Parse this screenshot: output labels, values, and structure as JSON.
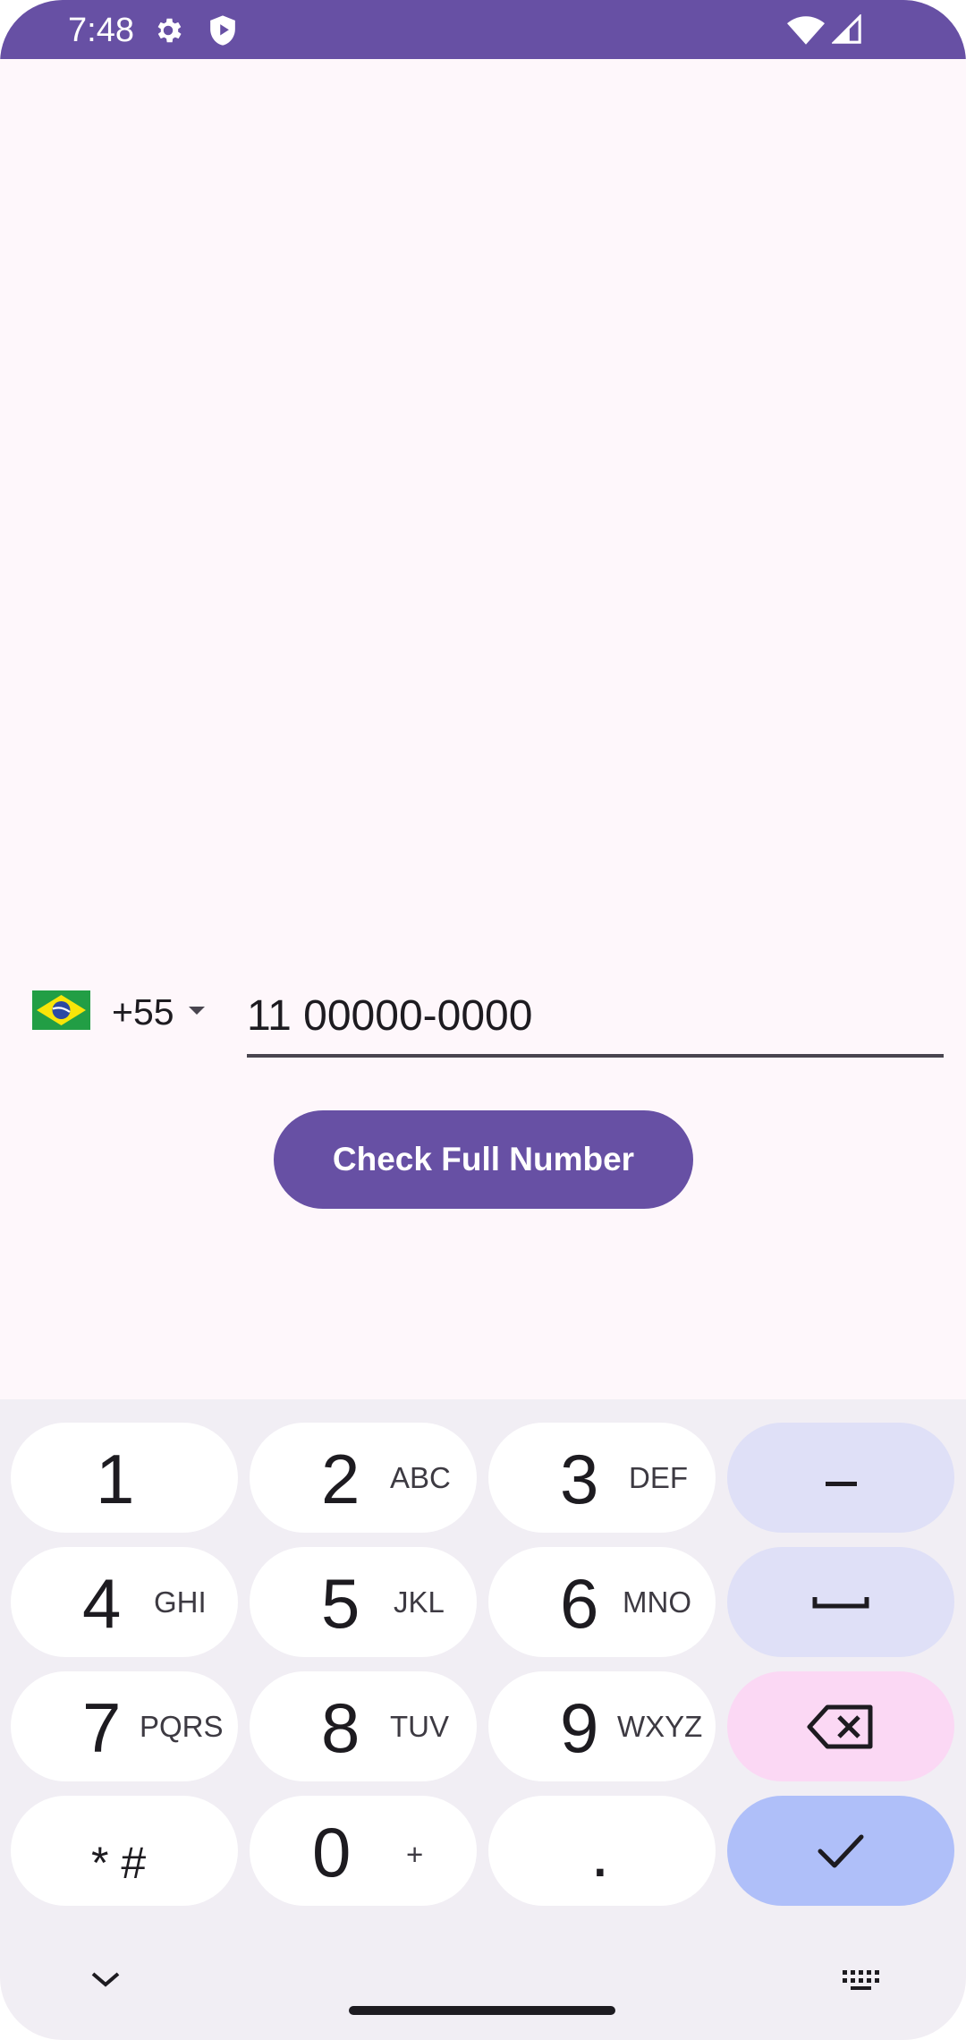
{
  "status_bar": {
    "time": "7:48",
    "icons": [
      "gear-icon",
      "shield-play-icon",
      "wifi-icon",
      "signal-icon"
    ],
    "background": "#6750a4"
  },
  "phone": {
    "flag": "brazil-flag-icon",
    "country_code": "+55",
    "number_value": "11 00000-0000"
  },
  "check_button": {
    "label": "Check Full Number",
    "color": "#6750a4"
  },
  "keyboard": {
    "keys": [
      {
        "digit": "1",
        "letters": ""
      },
      {
        "digit": "2",
        "letters": "ABC"
      },
      {
        "digit": "3",
        "letters": "DEF"
      },
      {
        "digit": "4",
        "letters": "GHI"
      },
      {
        "digit": "5",
        "letters": "JKL"
      },
      {
        "digit": "6",
        "letters": "MNO"
      },
      {
        "digit": "7",
        "letters": "PQRS"
      },
      {
        "digit": "8",
        "letters": "TUV"
      },
      {
        "digit": "9",
        "letters": "WXYZ"
      },
      {
        "digit": "* #",
        "letters": ""
      },
      {
        "digit": "0",
        "letters": "+"
      },
      {
        "digit": ".",
        "letters": ""
      }
    ],
    "function_keys": [
      "minus-icon",
      "space-bar-icon",
      "backspace-icon",
      "checkmark-icon"
    ]
  }
}
